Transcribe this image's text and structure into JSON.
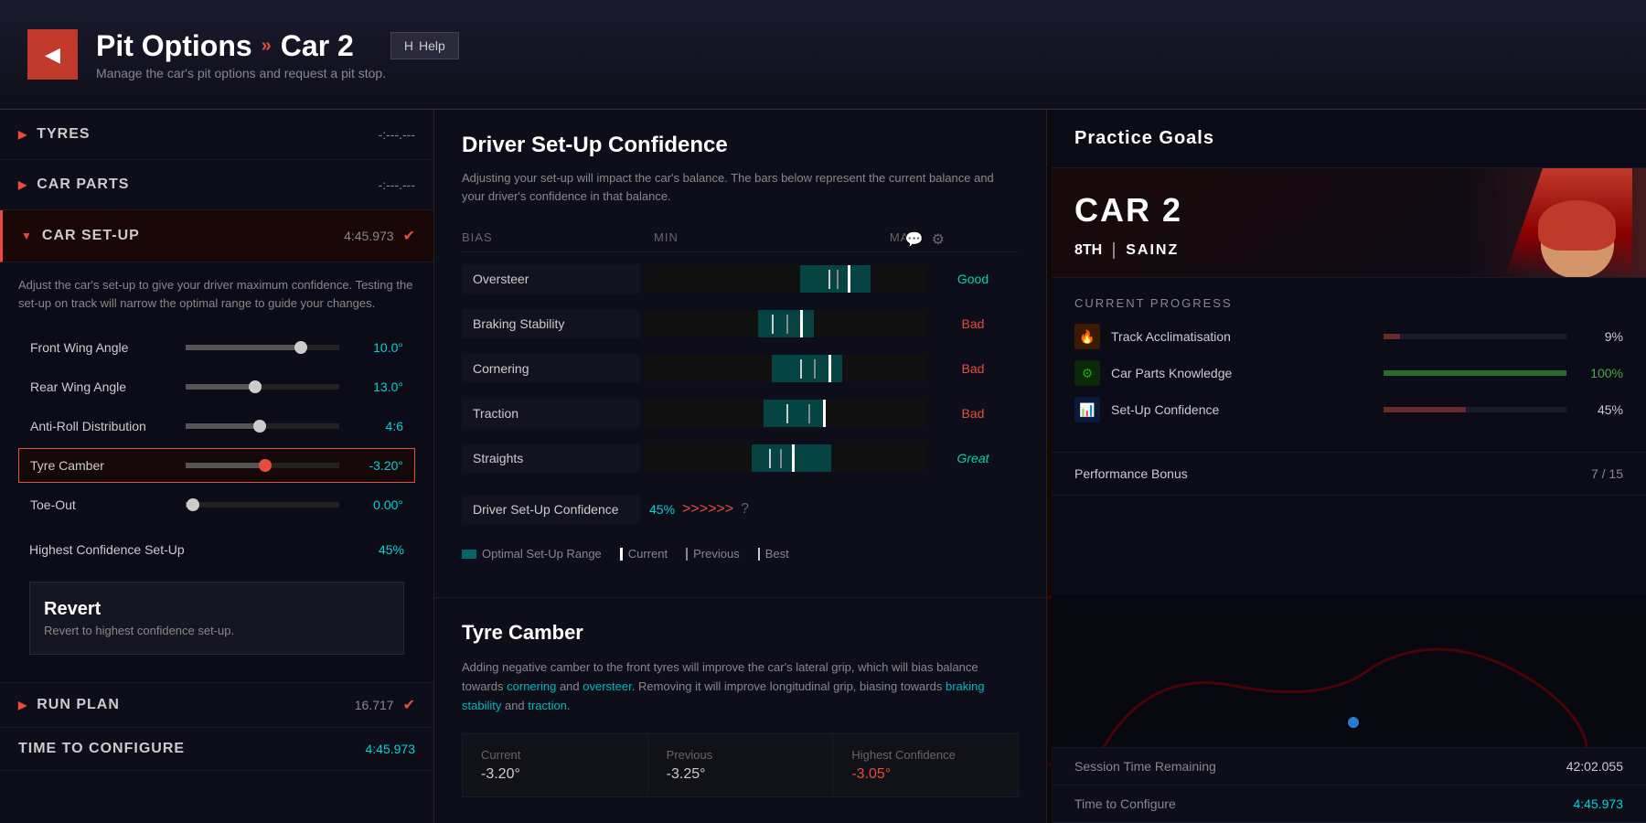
{
  "header": {
    "back_label": "◀",
    "title_part1": "Pit Options",
    "title_separator": "»",
    "title_part2": "Car 2",
    "help_key": "H",
    "help_label": "Help",
    "subtitle": "Manage the car's pit options and request a pit stop."
  },
  "left_panel": {
    "sections": [
      {
        "id": "tyres",
        "label": "TYRES",
        "value": "-:---.---",
        "expanded": false
      },
      {
        "id": "car_parts",
        "label": "CAR PARTS",
        "value": "-:---.---",
        "expanded": false
      },
      {
        "id": "car_setup",
        "label": "CAR SET-UP",
        "value": "4:45.973",
        "expanded": true,
        "check": true
      }
    ],
    "car_setup_desc": "Adjust the car's set-up to give your driver maximum confidence. Testing the set-up on track will narrow the optimal range to guide your changes.",
    "sliders": [
      {
        "label": "Front Wing Angle",
        "value": "10.0°",
        "position": 0.75
      },
      {
        "label": "Rear Wing Angle",
        "value": "13.0°",
        "position": 0.45
      },
      {
        "label": "Anti-Roll Distribution",
        "value": "4:6",
        "position": 0.48
      },
      {
        "label": "Tyre Camber",
        "value": "-3.20°",
        "position": 0.52,
        "active": true
      },
      {
        "label": "Toe-Out",
        "value": "0.00°",
        "position": 0.05
      }
    ],
    "highest_conf_label": "Highest Confidence Set-Up",
    "highest_conf_value": "45%",
    "revert_title": "Revert",
    "revert_sub": "Revert to highest confidence set-up.",
    "run_plan_label": "RUN PLAN",
    "run_plan_value": "16.717",
    "time_configure_label": "TIME TO CONFIGURE",
    "time_configure_value": "4:45.973"
  },
  "confidence_panel": {
    "title": "Driver Set-Up Confidence",
    "desc": "Adjusting your set-up will impact the car's balance. The bars below represent the current balance and your driver's confidence in that balance.",
    "columns": {
      "bias": "BIAS",
      "min": "MIN",
      "max": "MAX"
    },
    "rows": [
      {
        "label": "Oversteer",
        "result": "Good",
        "result_type": "good",
        "optimal_start": 0.55,
        "optimal_width": 0.25,
        "current": 0.72,
        "previous": 0.68,
        "best": 0.65
      },
      {
        "label": "Braking Stability",
        "result": "Bad",
        "result_type": "bad",
        "optimal_start": 0.4,
        "optimal_width": 0.2,
        "current": 0.55,
        "previous": 0.5,
        "best": 0.45
      },
      {
        "label": "Cornering",
        "result": "Bad",
        "result_type": "bad",
        "optimal_start": 0.45,
        "optimal_width": 0.25,
        "current": 0.65,
        "previous": 0.6,
        "best": 0.55
      },
      {
        "label": "Traction",
        "result": "Bad",
        "result_type": "bad",
        "optimal_start": 0.42,
        "optimal_width": 0.22,
        "current": 0.63,
        "previous": 0.58,
        "best": 0.5
      },
      {
        "label": "Straights",
        "result": "Great",
        "result_type": "great",
        "optimal_start": 0.38,
        "optimal_width": 0.28,
        "current": 0.52,
        "previous": 0.48,
        "best": 0.44
      }
    ],
    "driver_conf_label": "Driver Set-Up Confidence",
    "driver_conf_value": "45%",
    "driver_conf_arrows": ">>>>>>",
    "driver_conf_help": "?",
    "legend": {
      "optimal_label": "Optimal Set-Up Range",
      "current_label": "Current",
      "previous_label": "Previous",
      "best_label": "Best"
    }
  },
  "tyre_section": {
    "title": "Tyre Camber",
    "desc_part1": "Adding negative camber to the front tyres will improve the car's lateral grip, which will bias balance towards ",
    "link1": "cornering",
    "desc_part2": " and ",
    "link2": "oversteer",
    "desc_part3": ". Removing it will improve longitudinal grip, biasing towards ",
    "link3": "braking stability",
    "desc_part4": " and ",
    "link4": "traction",
    "desc_part5": ".",
    "compare": [
      {
        "label": "Current",
        "value": "-3.20°",
        "type": "normal"
      },
      {
        "label": "Previous",
        "value": "-3.25°",
        "type": "normal"
      },
      {
        "label": "Highest Confidence",
        "value": "-3.05°",
        "type": "best"
      }
    ]
  },
  "right_panel": {
    "title": "Practice Goals",
    "car_label": "CAR 2",
    "position": "8TH",
    "driver": "SAINZ",
    "progress_title": "CURRENT PROGRESS",
    "progress_items": [
      {
        "label": "Track Acclimatisation",
        "value": "9%",
        "percent": 9,
        "type": "low",
        "icon": "🔥"
      },
      {
        "label": "Car Parts Knowledge",
        "value": "100%",
        "percent": 100,
        "type": "full",
        "icon": "⚙"
      },
      {
        "label": "Set-Up Confidence",
        "value": "45%",
        "percent": 45,
        "type": "mid",
        "icon": "📊"
      }
    ],
    "perf_bonus_label": "Performance Bonus",
    "perf_bonus_value": "7 / 15"
  },
  "session": {
    "time_remaining_label": "Session Time Remaining",
    "time_remaining_value": "42:02.055",
    "time_configure_label": "Time to Configure",
    "time_configure_value": "4:45.973"
  }
}
